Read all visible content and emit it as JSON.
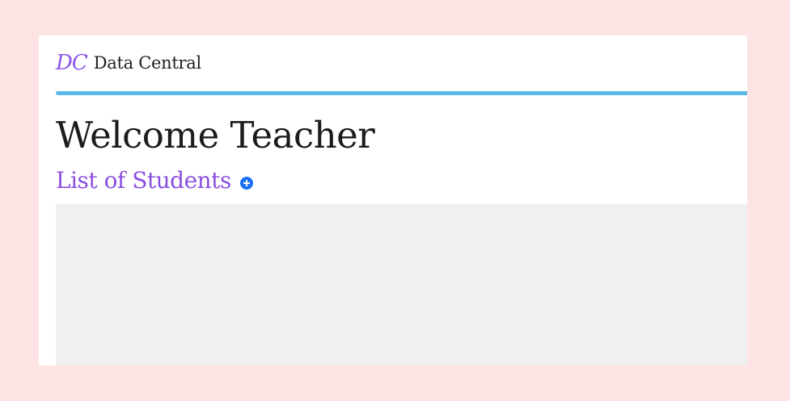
{
  "brand": {
    "logo_text": "DC",
    "name": "Data Central"
  },
  "main": {
    "title": "Welcome Teacher",
    "students_heading": "List of Students",
    "add_student_icon": "plus-circle-icon"
  },
  "colors": {
    "page_background": "#fde3e3",
    "brand_purple": "#8b55e8",
    "divider_blue": "#5bb8e8",
    "add_button_blue": "#1a6ff5",
    "panel_gray": "#f0f0f0"
  }
}
